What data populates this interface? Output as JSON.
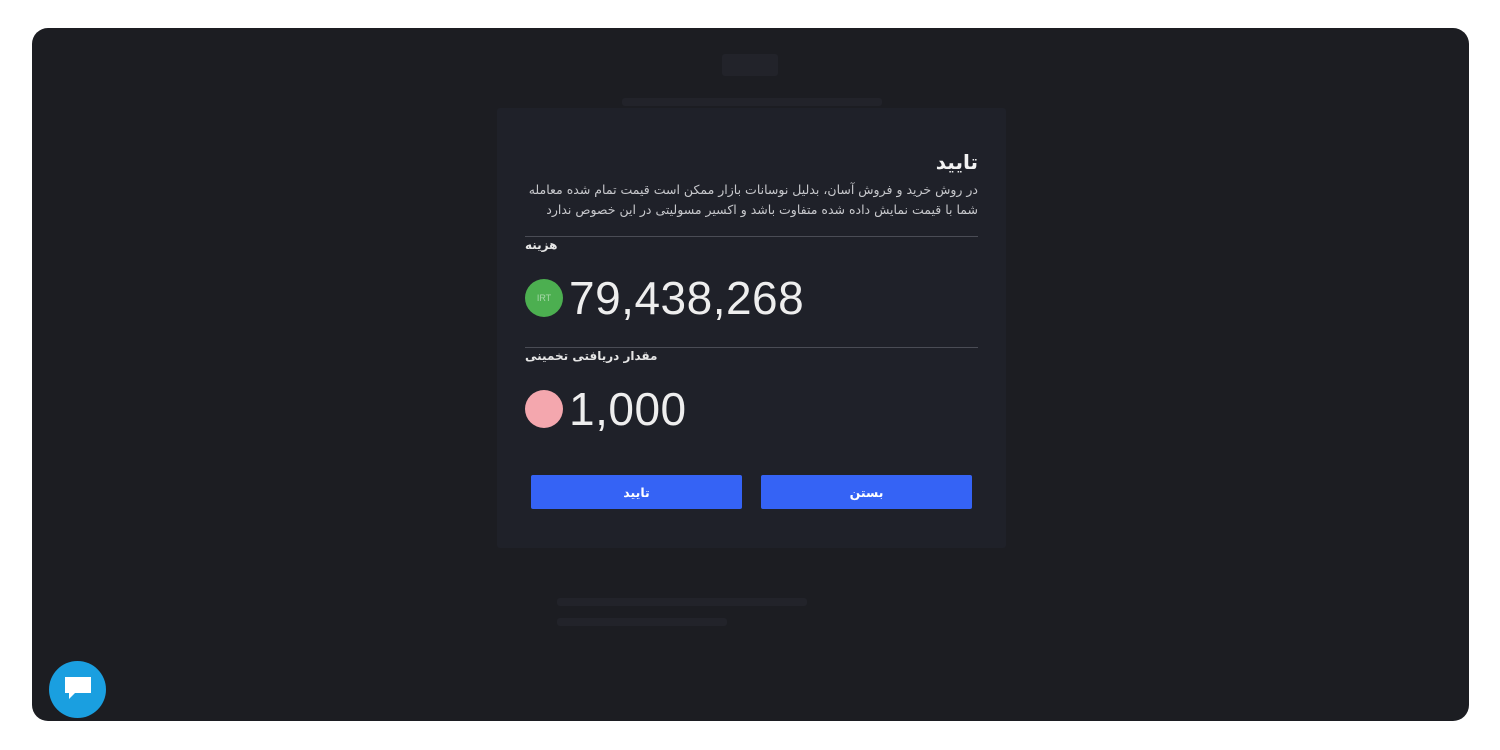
{
  "modal": {
    "title": "تایید",
    "description": "در روش خرید و فروش آسان، بدلیل نوسانات بازار ممکن است قیمت تمام شده معامله شما با قیمت نمایش داده شده متفاوت باشد و اکسیر مسولیتی در این خصوص ندارد",
    "cost_label": "هزینه",
    "cost_amount": "79,438,268",
    "cost_currency": "IRT",
    "receive_label": "مقدار دریافتی تخمینی",
    "receive_amount": "1,000",
    "confirm_label": "تایید",
    "close_label": "بستن"
  },
  "colors": {
    "primary_button": "#3563f5",
    "irt_coin": "#4caf50",
    "receive_coin": "#f4a7ae",
    "chat_button": "#1a9fe0"
  },
  "icons": {
    "chat": "chat-bubble-icon"
  }
}
